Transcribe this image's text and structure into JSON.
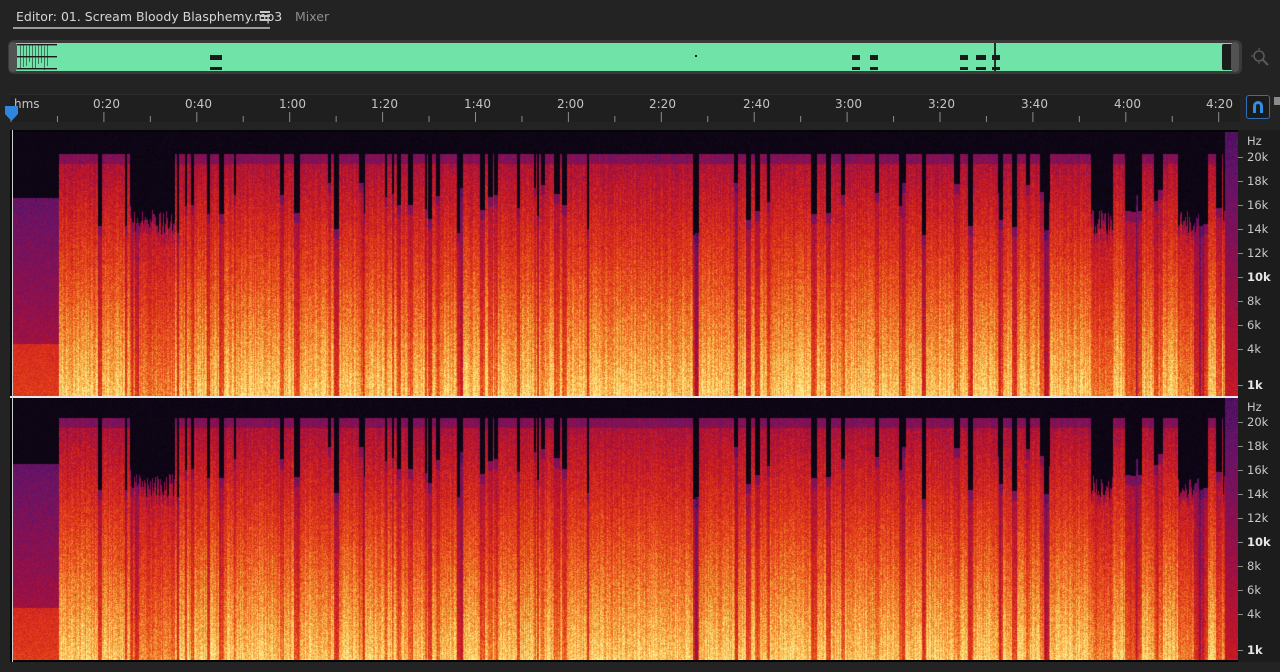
{
  "tabs": {
    "editor_label": "Editor: 01. Scream Bloody Blasphemy.mp3",
    "mixer_label": "Mixer"
  },
  "icons": {
    "panel_menu": "hamburger-menu-icon",
    "zoom": "zoom-navigator-icon",
    "playhead": "playhead-marker-icon",
    "snap": "magnet-snap-icon"
  },
  "colors": {
    "overview_wave": "#6fe3a8",
    "snap_border": "#2f6fb5",
    "playhead": "#2e86de",
    "spectro_low": "#fbe58a",
    "spectro_mid": "#e9531c",
    "spectro_high": "#b2123b",
    "spectro_faint": "#3d1768"
  },
  "ruler": {
    "unit_label": "hms",
    "time_labels": [
      "0:20",
      "0:40",
      "1:00",
      "1:20",
      "1:40",
      "2:00",
      "2:20",
      "2:40",
      "3:00",
      "3:20",
      "3:40",
      "4:00",
      "4:20"
    ]
  },
  "frequency_axis": {
    "unit": "Hz",
    "labels": [
      "20k",
      "18k",
      "16k",
      "14k",
      "12k",
      "10k",
      "8k",
      "6k",
      "4k",
      "1k"
    ],
    "bold_labels": [
      "10k",
      "1k"
    ]
  }
}
